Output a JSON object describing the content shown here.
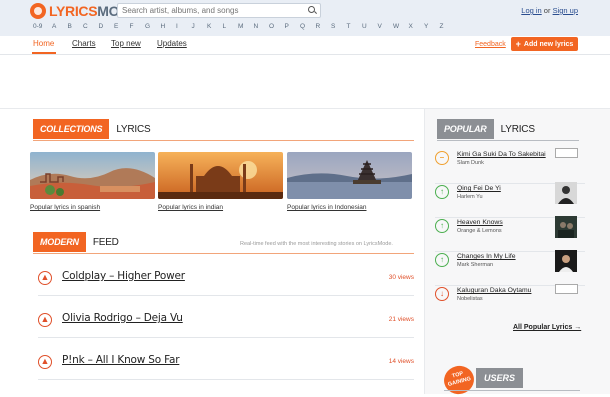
{
  "brand": {
    "part1": "LYRICS",
    "part2": "MODE"
  },
  "search": {
    "placeholder": "Search artist, albums, and songs"
  },
  "auth": {
    "login": "Log in",
    "or": " or ",
    "signup": "Sign up"
  },
  "alphabet": [
    "0-9",
    "A",
    "B",
    "C",
    "D",
    "E",
    "F",
    "G",
    "H",
    "I",
    "J",
    "K",
    "L",
    "M",
    "N",
    "O",
    "P",
    "Q",
    "R",
    "S",
    "T",
    "U",
    "V",
    "W",
    "X",
    "Y",
    "Z"
  ],
  "nav": {
    "tabs": [
      "Home",
      "Charts",
      "Top new",
      "Updates"
    ],
    "feedback": "Feedback",
    "add_button": "Add new lyrics"
  },
  "collections": {
    "pill": "COLLECTIONS",
    "word": "LYRICS",
    "items": [
      {
        "label": "Popular lyrics in spanish"
      },
      {
        "label": "Popular lyrics in indian"
      },
      {
        "label": "Popular lyrics in Indonesian"
      }
    ]
  },
  "modern": {
    "pill": "MODERN",
    "word": "FEED",
    "note": "Real-time feed with the most interesting stories on LyricsMode.",
    "tracks": [
      {
        "title": "Coldplay – Higher Power",
        "views": "30 views"
      },
      {
        "title": "Olivia Rodrigo – Deja Vu",
        "views": "21 views"
      },
      {
        "title": "P!nk – All I Know So Far",
        "views": "14 views"
      }
    ]
  },
  "popular": {
    "pill": "POPULAR",
    "word": "LYRICS",
    "items": [
      {
        "title": "Kimi Ga Suki Da To Sakebitai",
        "artist": "Slam Dunk",
        "trend": "flat"
      },
      {
        "title": "Qing Fei De Yi",
        "artist": "Harlem Yu",
        "trend": "up"
      },
      {
        "title": "Heaven Knows",
        "artist": "Orange & Lemons",
        "trend": "up"
      },
      {
        "title": "Changes In My Life",
        "artist": "Mark Sherman",
        "trend": "up"
      },
      {
        "title": "Kaluguran Daka Oytamu",
        "artist": "Nobelistas",
        "trend": "down"
      }
    ],
    "all_link": "All Popular Lyrics →"
  },
  "top_users": {
    "badge_line1": "TOP",
    "badge_line2": "GAINING",
    "pill": "USERS"
  },
  "colors": {
    "accent": "#f26522",
    "header_bg": "#e9eef5",
    "grey_pill": "#8c8f94"
  }
}
